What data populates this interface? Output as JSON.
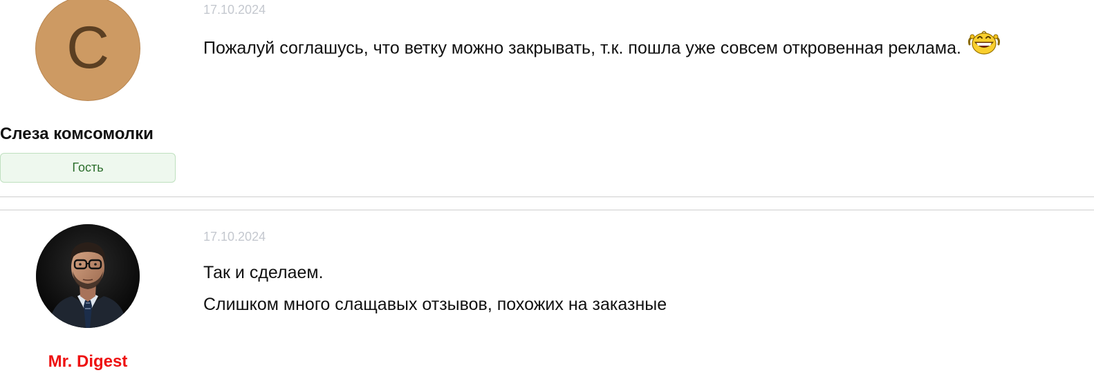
{
  "posts": [
    {
      "author": "Слеза комсомолки",
      "avatar_letter": "С",
      "role": "Гость",
      "date": "17.10.2024",
      "paragraphs": [
        "Пожалуй соглашусь, что ветку можно закрывать, т.к. пошла уже совсем откровенная реклама."
      ],
      "emoji": "laughing-smiley-icon"
    },
    {
      "author": "Mr. Digest",
      "avatar": "user-photo-avatar",
      "date": "17.10.2024",
      "paragraphs": [
        "Так и сделаем.",
        "Слишком много слащавых отзывов, похожих на заказные"
      ]
    }
  ],
  "colors": {
    "avatar_bg": "#cd9a63",
    "avatar_letter": "#5b3f22",
    "guest_badge_bg": "#eef8ee",
    "guest_badge_border": "#bfe0bf",
    "guest_badge_text": "#2b6e2b",
    "admin_name": "#ee1111",
    "date_text": "#c4c8cf"
  }
}
